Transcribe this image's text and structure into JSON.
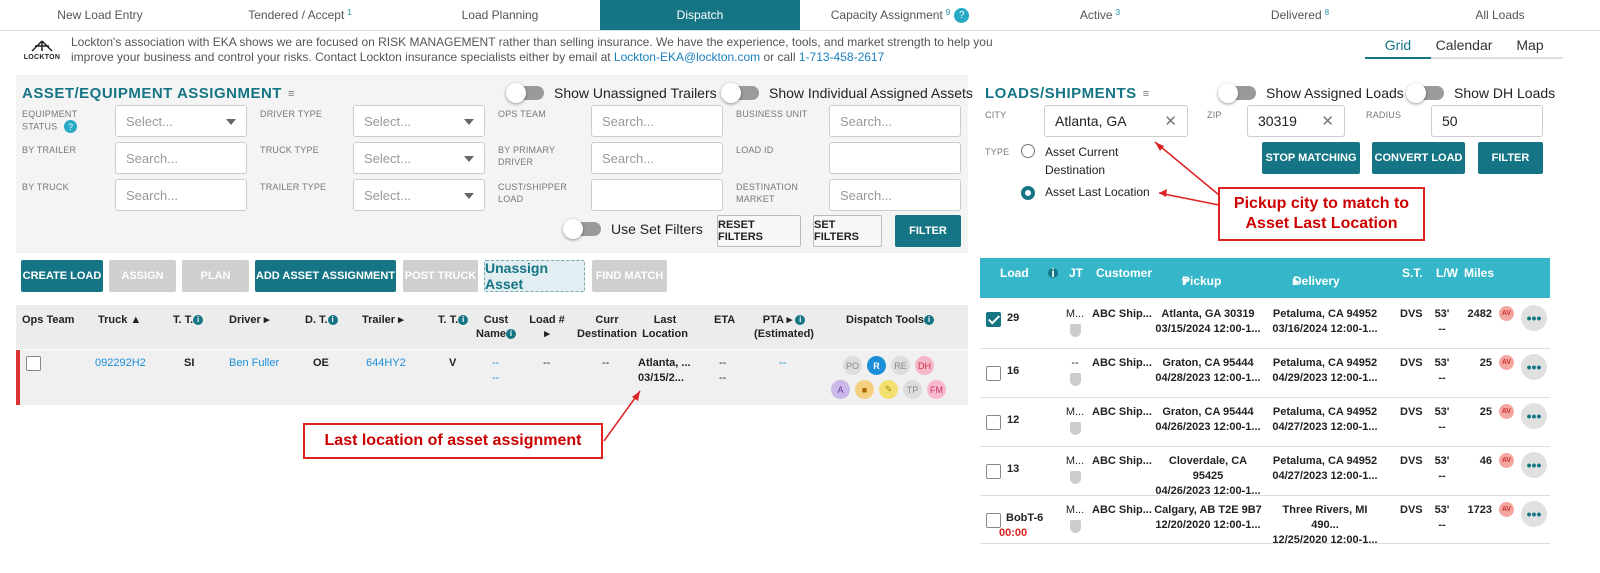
{
  "nav": {
    "tabs": [
      {
        "label": "New Load Entry",
        "badge": ""
      },
      {
        "label": "Tendered / Accept",
        "badge": "1"
      },
      {
        "label": "Load Planning",
        "badge": ""
      },
      {
        "label": "Dispatch",
        "badge": ""
      },
      {
        "label": "Capacity Assignment",
        "badge": "9"
      },
      {
        "label": "Active",
        "badge": "3"
      },
      {
        "label": "Delivered",
        "badge": "8"
      },
      {
        "label": "All Loads",
        "badge": ""
      }
    ],
    "help_icon": "?"
  },
  "banner": {
    "logo_text": "LOCKTON",
    "text": "Lockton's association with EKA shows we are focused on RISK MANAGEMENT rather than selling insurance. We have the experience, tools, and market strength to help you improve your business and control your risks. Contact Lockton insurance specialists either by email at ",
    "email": "Lockton-EKA@lockton.com",
    "mid": " or call ",
    "phone": "1-713-458-2617"
  },
  "views": {
    "grid": "Grid",
    "calendar": "Calendar",
    "map": "Map"
  },
  "asset": {
    "title": "ASSET/EQUIPMENT ASSIGNMENT",
    "toggle_trailers": "Show Unassigned Trailers",
    "toggle_assets": "Show Individual Assigned Assets",
    "labels": {
      "equipment_status": "EQUIPMENT STATUS",
      "by_trailer": "BY TRAILER",
      "by_truck": "BY TRUCK",
      "driver_type": "DRIVER TYPE",
      "truck_type": "TRUCK TYPE",
      "trailer_type": "TRAILER TYPE",
      "ops_team": "OPS TEAM",
      "by_primary_driver": "BY PRIMARY DRIVER",
      "cust_shipper_load": "CUST/SHIPPER LOAD",
      "business_unit": "BUSINESS UNIT",
      "load_id": "LOAD ID",
      "destination_market": "DESTINATION MARKET"
    },
    "placeholders": {
      "select": "Select...",
      "search": "Search..."
    },
    "use_set_filters": "Use Set Filters",
    "reset_filters": "RESET FILTERS",
    "set_filters": "SET FILTERS",
    "filter": "FILTER",
    "actions": {
      "create_load": "CREATE LOAD",
      "assign": "ASSIGN",
      "plan": "PLAN",
      "add_asset_assignment": "ADD ASSET ASSIGNMENT",
      "post_truck": "POST TRUCK",
      "unassign_asset": "Unassign Asset",
      "find_match": "FIND MATCH"
    },
    "columns": {
      "ops_team": "Ops Team",
      "truck": "Truck",
      "tt": "T. T.",
      "driver": "Driver",
      "dt": "D. T.",
      "trailer": "Trailer",
      "tt2": "T. T.",
      "cust_name": "Cust Name",
      "load_num": "Load #",
      "curr_destination": "Curr Destination",
      "last_location": "Last Location",
      "eta": "ETA",
      "pta": "PTA",
      "pta_est": "(Estimated)",
      "dispatch_tools": "Dispatch Tools"
    },
    "row": {
      "truck": "092292H2",
      "tt": "SI",
      "driver": "Ben Fuller",
      "dt": "OE",
      "trailer": "644HY2",
      "tt2": "V",
      "cust1": "--",
      "cust2": "--",
      "load": "--",
      "curr_dest": "--",
      "last_loc1": "Atlanta, ...",
      "last_loc2": "03/15/2...",
      "eta1": "--",
      "eta2": "--",
      "pta": "--",
      "tools": [
        "PO",
        "R",
        "RE",
        "DH",
        "A",
        "■",
        "✎",
        "TP",
        "FM"
      ]
    },
    "callout": "Last location of asset assignment"
  },
  "loads": {
    "title": "LOADS/SHIPMENTS",
    "toggle_assigned": "Show Assigned Loads",
    "toggle_dh": "Show DH Loads",
    "city_label": "CITY",
    "city_value": "Atlanta, GA",
    "zip_label": "ZIP",
    "zip_value": "30319",
    "radius_label": "RADIUS",
    "radius_value": "50",
    "type_label": "TYPE",
    "type_opt1": "Asset Current Destination",
    "type_opt2": "Asset Last Location",
    "stop_matching": "STOP MATCHING",
    "convert_load": "CONVERT LOAD",
    "filter": "FILTER",
    "callout": "Pickup city to match to Asset Last Location",
    "columns": {
      "load": "Load",
      "jt": "JT",
      "customer": "Customer",
      "pickup": "Pickup",
      "delivery": "Delivery",
      "st": "S.T.",
      "lw": "L/W",
      "miles": "Miles"
    },
    "rows": [
      {
        "load": "29",
        "jt": "M...",
        "customer": "ABC Ship...",
        "pickup1": "Atlanta, GA 30319",
        "pickup2": "03/15/2024 12:00-1...",
        "delivery1": "Petaluma, CA 94952",
        "delivery2": "03/16/2024 12:00-1...",
        "st": "DVS",
        "lw1": "53'",
        "lw2": "--",
        "miles": "2482",
        "av": "AV",
        "checked": true,
        "extra": ""
      },
      {
        "load": "16",
        "jt": "--",
        "customer": "ABC Ship...",
        "pickup1": "Graton, CA 95444",
        "pickup2": "04/28/2023 12:00-1...",
        "delivery1": "Petaluma, CA 94952",
        "delivery2": "04/29/2023 12:00-1...",
        "st": "DVS",
        "lw1": "53'",
        "lw2": "--",
        "miles": "25",
        "av": "AV",
        "checked": false,
        "extra": ""
      },
      {
        "load": "12",
        "jt": "M...",
        "customer": "ABC Ship...",
        "pickup1": "Graton, CA 95444",
        "pickup2": "04/26/2023 12:00-1...",
        "delivery1": "Petaluma, CA 94952",
        "delivery2": "04/27/2023 12:00-1...",
        "st": "DVS",
        "lw1": "53'",
        "lw2": "--",
        "miles": "25",
        "av": "AV",
        "checked": false,
        "extra": ""
      },
      {
        "load": "13",
        "jt": "M...",
        "customer": "ABC Ship...",
        "pickup1": "Cloverdale, CA 95425",
        "pickup2": "04/26/2023 12:00-1...",
        "delivery1": "Petaluma, CA 94952",
        "delivery2": "04/27/2023 12:00-1...",
        "st": "DVS",
        "lw1": "53'",
        "lw2": "--",
        "miles": "46",
        "av": "AV",
        "checked": false,
        "extra": ""
      },
      {
        "load": "BobT-6",
        "jt": "M...",
        "customer": "ABC Ship...",
        "pickup1": "Calgary, AB T2E 9B7",
        "pickup2": "12/20/2020 12:00-1...",
        "delivery1": "Three Rivers, MI 490...",
        "delivery2": "12/25/2020 12:00-1...",
        "st": "DVS",
        "lw1": "53'",
        "lw2": "--",
        "miles": "1723",
        "av": "AV",
        "checked": false,
        "extra": "00:00"
      }
    ],
    "more": "•••"
  }
}
